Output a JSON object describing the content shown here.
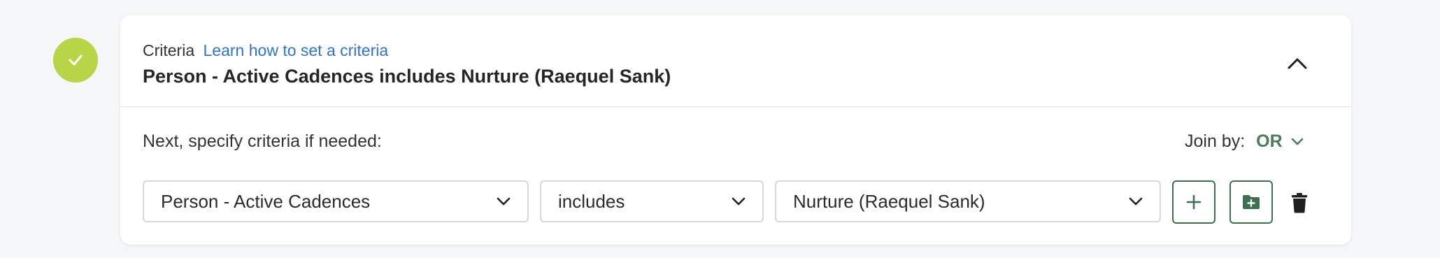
{
  "step": {
    "status": "complete",
    "icon": "check-icon",
    "color": "#b8d548"
  },
  "header": {
    "label": "Criteria",
    "link_text": "Learn how to set a criteria",
    "title": "Person - Active Cadences includes Nurture (Raequel Sank)",
    "collapse_icon": "chevron-up-icon"
  },
  "body": {
    "next_label": "Next, specify criteria if needed:",
    "join_label": "Join by:",
    "join_value": "OR"
  },
  "rule": {
    "field": "Person - Active Cadences",
    "operator": "includes",
    "value": "Nurture (Raequel Sank)"
  },
  "actions": {
    "add_icon": "plus-icon",
    "group_icon": "folder-plus-icon",
    "delete_icon": "trash-icon"
  },
  "colors": {
    "accent_green": "#3d6f51",
    "join_green": "#4a7c5c",
    "link_blue": "#2f74d0",
    "badge_green": "#b8d548"
  }
}
